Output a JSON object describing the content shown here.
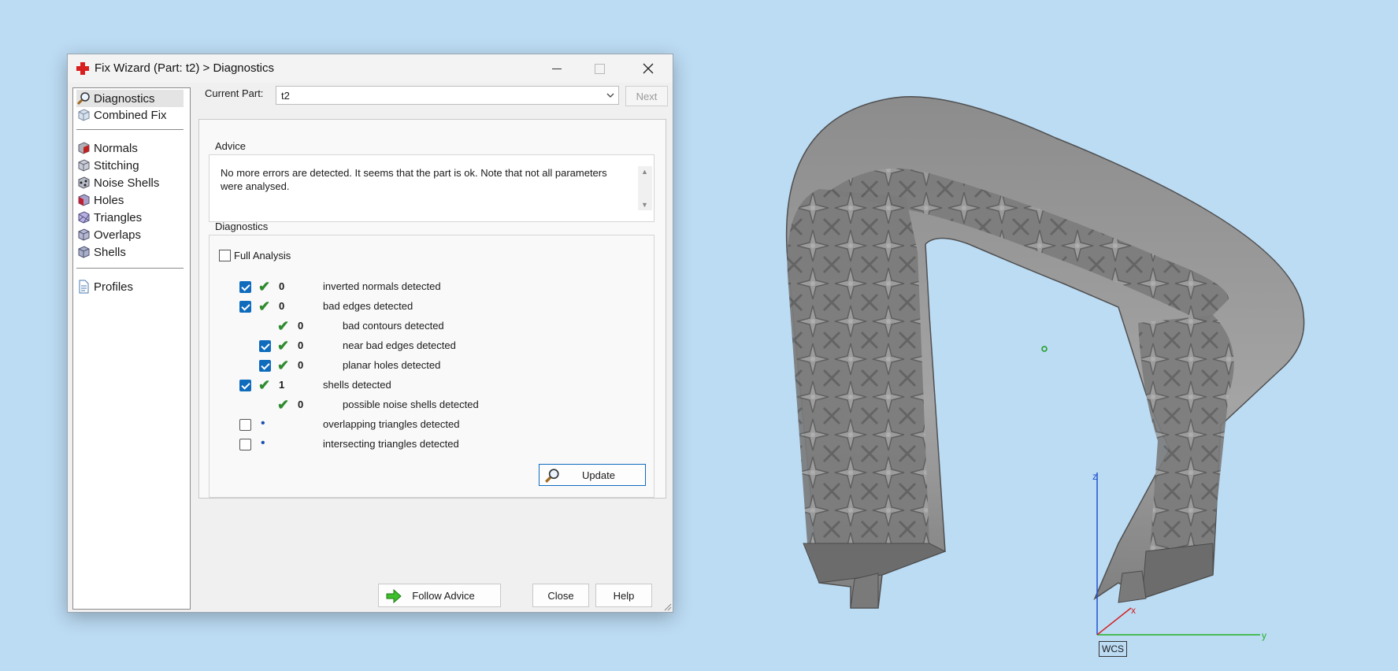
{
  "window": {
    "title": "Fix Wizard (Part: t2) > Diagnostics",
    "icon": "red-cross-icon"
  },
  "sidebar": {
    "items": [
      {
        "label": "Diagnostics",
        "icon": "magnifier-icon",
        "selected": true
      },
      {
        "label": "Combined Fix",
        "icon": "cube-icon"
      },
      {
        "label": "Normals",
        "icon": "normals-cube-icon"
      },
      {
        "label": "Stitching",
        "icon": "stitching-cube-icon"
      },
      {
        "label": "Noise Shells",
        "icon": "noise-shells-icon"
      },
      {
        "label": "Holes",
        "icon": "holes-cube-icon"
      },
      {
        "label": "Triangles",
        "icon": "triangles-cube-icon"
      },
      {
        "label": "Overlaps",
        "icon": "overlaps-cube-icon"
      },
      {
        "label": "Shells",
        "icon": "shells-cube-icon"
      },
      {
        "label": "Profiles",
        "icon": "document-icon"
      }
    ]
  },
  "current_part": {
    "label": "Current Part:",
    "value": "t2"
  },
  "next_label": "Next",
  "advice": {
    "group_label": "Advice",
    "text": "No more errors are detected. It seems that the part is ok. Note that not all parameters were analysed."
  },
  "diagnostics": {
    "group_label": "Diagnostics",
    "full_analysis_label": "Full Analysis",
    "rows": [
      {
        "count": "0",
        "text": "inverted normals detected",
        "checkbox": "checked",
        "status": "ok"
      },
      {
        "count": "0",
        "text": "bad edges detected",
        "checkbox": "checked",
        "status": "ok"
      },
      {
        "count": "0",
        "text": "bad contours detected",
        "checkbox": "none",
        "status": "ok"
      },
      {
        "count": "0",
        "text": "near bad edges detected",
        "checkbox": "checked",
        "status": "ok"
      },
      {
        "count": "0",
        "text": "planar holes detected",
        "checkbox": "checked",
        "status": "ok"
      },
      {
        "count": "1",
        "text": "shells detected",
        "checkbox": "checked",
        "status": "ok"
      },
      {
        "count": "0",
        "text": "possible noise shells detected",
        "checkbox": "none",
        "status": "ok"
      },
      {
        "count": "",
        "text": "overlapping triangles detected",
        "checkbox": "unchecked",
        "status": "pending"
      },
      {
        "count": "",
        "text": "intersecting triangles detected",
        "checkbox": "unchecked",
        "status": "pending"
      }
    ],
    "update_label": "Update"
  },
  "buttons": {
    "follow_advice": "Follow Advice",
    "close": "Close",
    "help": "Help"
  },
  "viewport": {
    "axes": {
      "x": "x",
      "y": "y",
      "z": "z"
    },
    "coordinate_system_label": "WCS",
    "colors": {
      "background": "#bcdcf4",
      "model": "#8a8a8a",
      "x_axis": "#d42020",
      "y_axis": "#20b020",
      "z_axis": "#2050d0"
    }
  }
}
